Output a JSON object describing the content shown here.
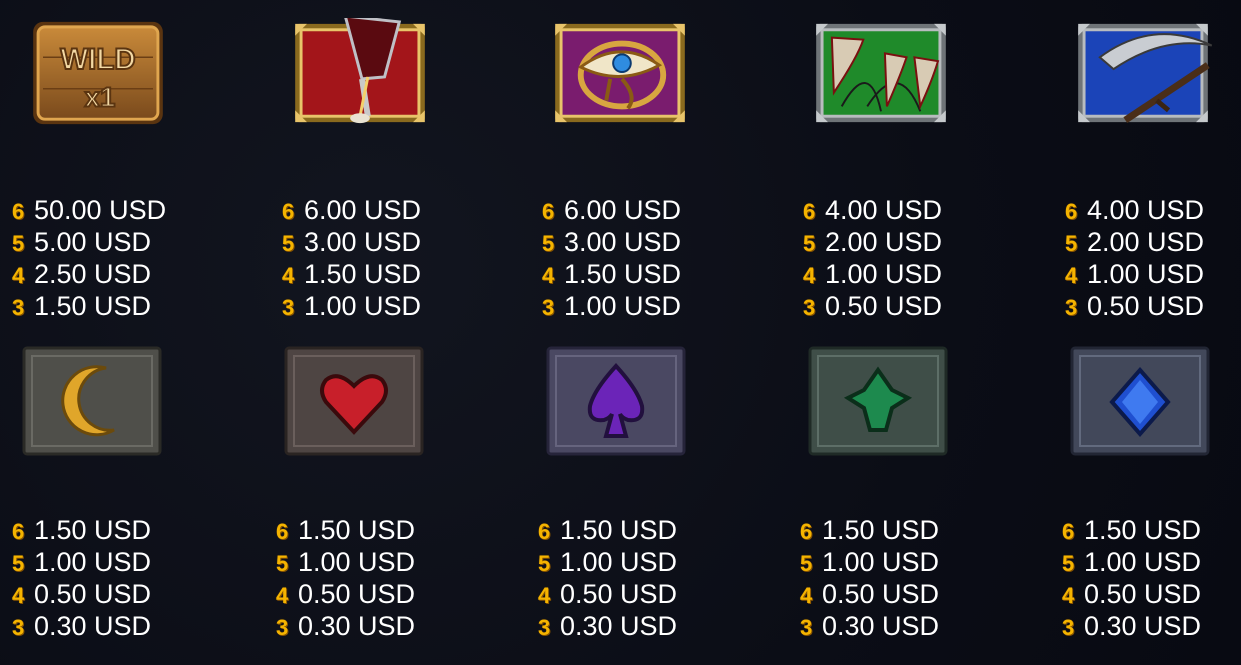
{
  "symbols": [
    {
      "name": "wild",
      "icon": "wild-x1-icon",
      "icon_text": [
        "WILD",
        "x1"
      ],
      "pays": [
        {
          "count": "6",
          "amount": "50.00 USD"
        },
        {
          "count": "5",
          "amount": "5.00 USD"
        },
        {
          "count": "4",
          "amount": "2.50 USD"
        },
        {
          "count": "3",
          "amount": "1.50 USD"
        }
      ]
    },
    {
      "name": "goblet",
      "icon": "blood-goblet-icon",
      "pays": [
        {
          "count": "6",
          "amount": "6.00 USD"
        },
        {
          "count": "5",
          "amount": "3.00 USD"
        },
        {
          "count": "4",
          "amount": "1.50 USD"
        },
        {
          "count": "3",
          "amount": "1.00 USD"
        }
      ]
    },
    {
      "name": "eye",
      "icon": "eye-of-horus-icon",
      "pays": [
        {
          "count": "6",
          "amount": "6.00 USD"
        },
        {
          "count": "5",
          "amount": "3.00 USD"
        },
        {
          "count": "4",
          "amount": "1.50 USD"
        },
        {
          "count": "3",
          "amount": "1.00 USD"
        }
      ]
    },
    {
      "name": "fangs",
      "icon": "fangs-icon",
      "pays": [
        {
          "count": "6",
          "amount": "4.00 USD"
        },
        {
          "count": "5",
          "amount": "2.00 USD"
        },
        {
          "count": "4",
          "amount": "1.00 USD"
        },
        {
          "count": "3",
          "amount": "0.50 USD"
        }
      ]
    },
    {
      "name": "scythe",
      "icon": "scythe-icon",
      "pays": [
        {
          "count": "6",
          "amount": "4.00 USD"
        },
        {
          "count": "5",
          "amount": "2.00 USD"
        },
        {
          "count": "4",
          "amount": "1.00 USD"
        },
        {
          "count": "3",
          "amount": "0.50 USD"
        }
      ]
    },
    {
      "name": "moon",
      "icon": "crescent-moon-icon",
      "pays": [
        {
          "count": "6",
          "amount": "1.50 USD"
        },
        {
          "count": "5",
          "amount": "1.00 USD"
        },
        {
          "count": "4",
          "amount": "0.50 USD"
        },
        {
          "count": "3",
          "amount": "0.30 USD"
        }
      ]
    },
    {
      "name": "heart",
      "icon": "heart-icon",
      "pays": [
        {
          "count": "6",
          "amount": "1.50 USD"
        },
        {
          "count": "5",
          "amount": "1.00 USD"
        },
        {
          "count": "4",
          "amount": "0.50 USD"
        },
        {
          "count": "3",
          "amount": "0.30 USD"
        }
      ]
    },
    {
      "name": "spade",
      "icon": "spade-icon",
      "pays": [
        {
          "count": "6",
          "amount": "1.50 USD"
        },
        {
          "count": "5",
          "amount": "1.00 USD"
        },
        {
          "count": "4",
          "amount": "0.50 USD"
        },
        {
          "count": "3",
          "amount": "0.30 USD"
        }
      ]
    },
    {
      "name": "club",
      "icon": "club-icon",
      "pays": [
        {
          "count": "6",
          "amount": "1.50 USD"
        },
        {
          "count": "5",
          "amount": "1.00 USD"
        },
        {
          "count": "4",
          "amount": "0.50 USD"
        },
        {
          "count": "3",
          "amount": "0.30 USD"
        }
      ]
    },
    {
      "name": "diamond",
      "icon": "diamond-icon",
      "pays": [
        {
          "count": "6",
          "amount": "1.50 USD"
        },
        {
          "count": "5",
          "amount": "1.00 USD"
        },
        {
          "count": "4",
          "amount": "0.50 USD"
        },
        {
          "count": "3",
          "amount": "0.30 USD"
        }
      ]
    }
  ],
  "colors": {
    "count_gold": "#f5b400",
    "text": "#ffffff",
    "background": "#0b0d16"
  }
}
